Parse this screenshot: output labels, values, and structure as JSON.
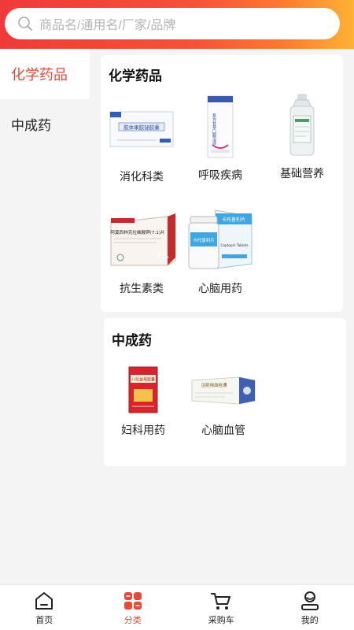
{
  "search": {
    "placeholder": "商品名/通用名/厂家/品牌"
  },
  "sidebar": {
    "items": [
      {
        "label": "化学药品"
      },
      {
        "label": "中成药"
      }
    ]
  },
  "sections": [
    {
      "title": "化学药品",
      "products": [
        {
          "label": "消化科类",
          "pack_text": "胶体果胶铋胶囊"
        },
        {
          "label": "呼吸疾病",
          "pack_text": "复方甘草口服溶液"
        },
        {
          "label": "基础营养"
        },
        {
          "label": "抗生素类",
          "pack_text": "阿莫西林克拉维酸钾(7:1)片",
          "ratio": "7:1"
        },
        {
          "label": "心脑用药",
          "pack_text": "卡托普利片",
          "pack_sub": "Captopril Tablets"
        }
      ]
    },
    {
      "title": "中成药",
      "products": [
        {
          "label": "妇科用药",
          "pack_text": "八珍益母胶囊"
        },
        {
          "label": "心脑血管",
          "pack_text": "注射用血栓通"
        }
      ]
    }
  ],
  "tabbar": {
    "items": [
      {
        "label": "首页"
      },
      {
        "label": "分类"
      },
      {
        "label": "采购车"
      },
      {
        "label": "我的"
      }
    ]
  },
  "colors": {
    "accent": "#e8473a",
    "header_start": "#f03a3a",
    "header_end": "#ffb235"
  }
}
